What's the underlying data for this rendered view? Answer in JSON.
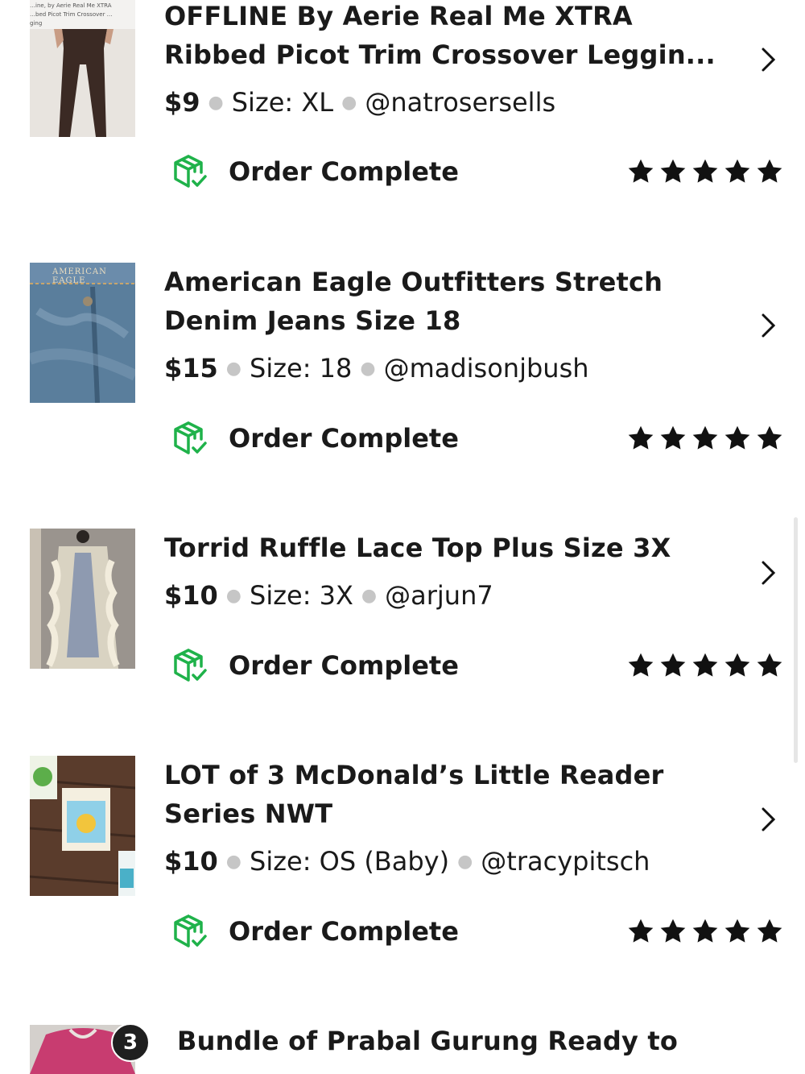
{
  "orders": [
    {
      "title": "OFFLINE By Aerie Real Me XTRA Ribbed Picot Trim Crossover Leggin...",
      "price": "$9",
      "size": "Size: XL",
      "seller": "@natrosersells",
      "status": "Order Complete",
      "rating": 5,
      "thumb_caption": "…ine, by Aerie Real Me XTRA …bed Picot Trim Crossover …ging"
    },
    {
      "title": "American Eagle Outfitters Stretch Denim Jeans Size 18",
      "price": "$15",
      "size": "Size: 18",
      "seller": "@madisonjbush",
      "status": "Order Complete",
      "rating": 5,
      "thumb_caption": "AMERICAN EAGLE"
    },
    {
      "title": "Torrid Ruffle Lace Top Plus Size 3X",
      "price": "$10",
      "size": "Size: 3X",
      "seller": "@arjun7",
      "status": "Order Complete",
      "rating": 5
    },
    {
      "title": "LOT of 3 McDonald’s Little Reader Series NWT",
      "price": "$10",
      "size": "Size: OS (Baby)",
      "seller": "@tracypitsch",
      "status": "Order Complete",
      "rating": 5
    },
    {
      "title": "Bundle of Prabal Gurung Ready to",
      "bundle_count": "3"
    }
  ],
  "icons": {
    "status": "box-check-icon",
    "chevron": "chevron-right-icon",
    "star": "star-icon"
  },
  "colors": {
    "status_green": "#1fb24a",
    "text": "#1a1a1a",
    "star": "#111111"
  }
}
